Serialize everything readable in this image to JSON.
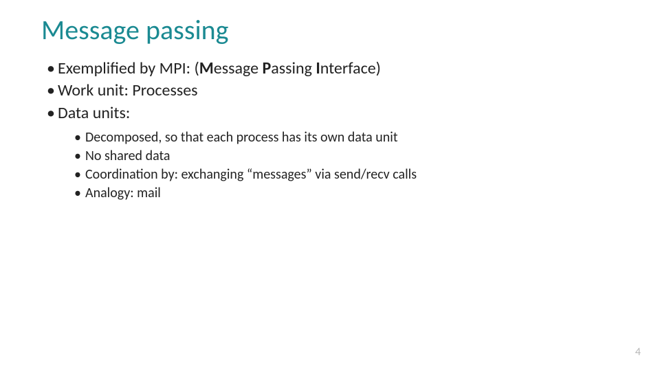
{
  "title": "Message passing",
  "bullets_l1": [
    {
      "prefix": "Exemplified by MPI: (",
      "b1": "M",
      "m1": "essage ",
      "b2": "P",
      "m2": "assing ",
      "b3": "I",
      "m3": "nterface)"
    },
    {
      "text": "Work unit: Processes"
    },
    {
      "text": "Data units:"
    }
  ],
  "bullets_l2": [
    "Decomposed, so that each process has its own data unit",
    "No shared data",
    "Coordination by: exchanging “messages” via send/recv calls",
    "Analogy: mail"
  ],
  "page_number": "4",
  "bullet_char": "•"
}
